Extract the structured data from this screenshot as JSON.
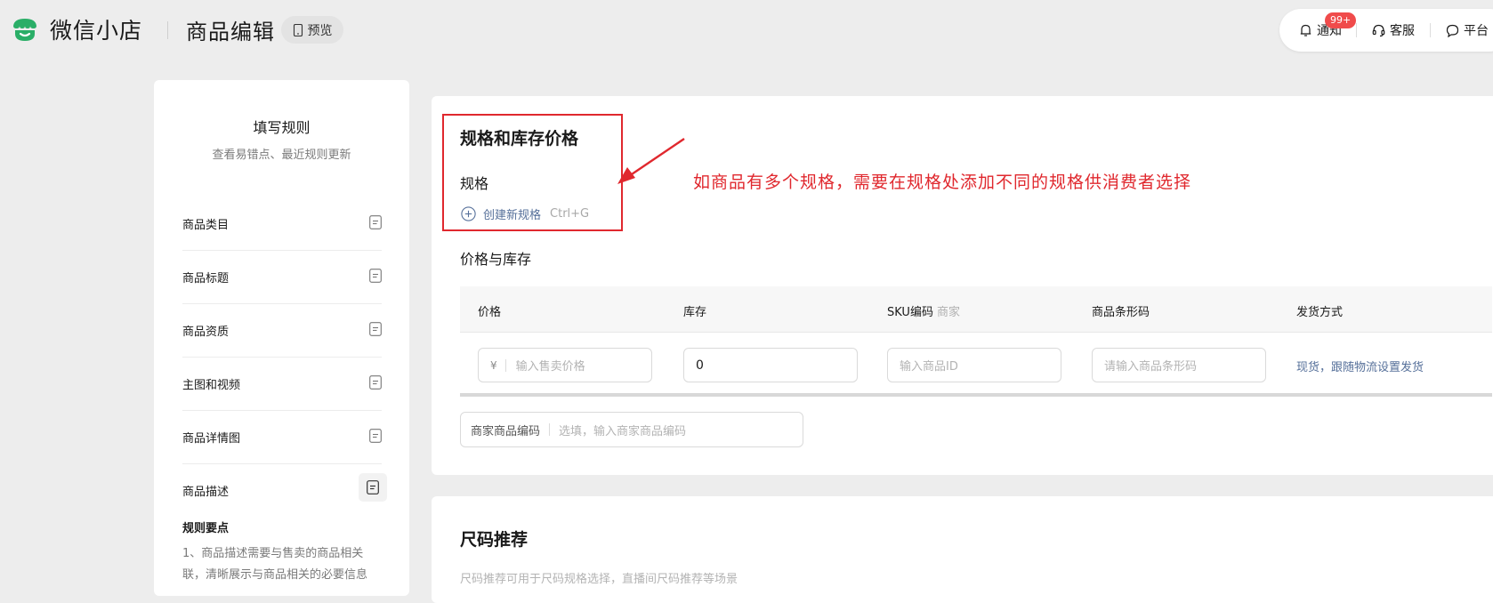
{
  "header": {
    "brand": "微信小店",
    "page_title": "商品编辑",
    "preview_label": "预览",
    "notify_label": "通知",
    "notify_badge": "99+",
    "service_label": "客服",
    "platform_label": "平台"
  },
  "sidebar": {
    "title": "填写规则",
    "subtitle": "查看易错点、最近规则更新",
    "items": [
      {
        "label": "商品类目"
      },
      {
        "label": "商品标题"
      },
      {
        "label": "商品资质"
      },
      {
        "label": "主图和视频"
      },
      {
        "label": "商品详情图"
      },
      {
        "label": "商品描述"
      }
    ],
    "rule_title": "规则要点",
    "rule_text": "1、商品描述需要与售卖的商品相关联，清晰展示与商品相关的必要信息"
  },
  "spec": {
    "title": "规格和库存价格",
    "label": "规格",
    "create_label": "创建新规格",
    "shortcut": "Ctrl+G",
    "annotation": "如商品有多个规格，需要在规格处添加不同的规格供消费者选择"
  },
  "stock": {
    "title": "价格与库存",
    "columns": [
      "价格",
      "库存",
      "SKU编码",
      "商品条形码",
      "发货方式"
    ],
    "sku_hint": "商家",
    "price_currency": "¥",
    "price_placeholder": "输入售卖价格",
    "stock_value": "0",
    "sku_placeholder": "输入商品ID",
    "barcode_placeholder": "请输入商品条形码",
    "delivery": "现货，跟随物流设置发货"
  },
  "merchant_code": {
    "label": "商家商品编码",
    "placeholder": "选填，输入商家商品编码"
  },
  "size": {
    "title": "尺码推荐",
    "desc": "尺码推荐可用于尺码规格选择，直播间尺码推荐等场景"
  },
  "colors": {
    "accent_red": "#e0282e",
    "link_blue": "#56709a",
    "logo_green": "#2aae67",
    "badge_red": "#f04b4b"
  }
}
